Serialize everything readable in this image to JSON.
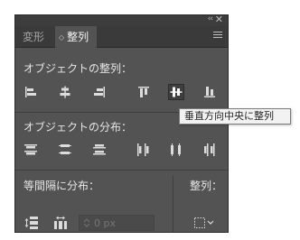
{
  "panel": {
    "title_bar": {
      "collapse_icon": "double-chevron-left-icon",
      "close_icon": "close-icon",
      "collapse_glyph": "‹‹",
      "close_glyph": "✕"
    },
    "tabs": [
      {
        "label": "変形",
        "active": false
      },
      {
        "label": "整列",
        "active": true,
        "arrows": "◇"
      }
    ],
    "menu_icon": "hamburger-menu-icon"
  },
  "align_objects": {
    "title": "オブジェクトの整列：",
    "buttons": [
      {
        "icon": "align-left-icon"
      },
      {
        "icon": "align-horizontal-center-icon"
      },
      {
        "icon": "align-right-icon"
      },
      {
        "icon": "align-top-icon"
      },
      {
        "icon": "align-vertical-center-icon",
        "active": true
      },
      {
        "icon": "align-bottom-icon"
      }
    ]
  },
  "distribute_objects": {
    "title": "オブジェクトの分布：",
    "buttons": [
      {
        "icon": "distribute-top-icon"
      },
      {
        "icon": "distribute-vertical-center-icon"
      },
      {
        "icon": "distribute-bottom-icon"
      },
      {
        "icon": "distribute-left-icon"
      },
      {
        "icon": "distribute-horizontal-center-icon"
      },
      {
        "icon": "distribute-right-icon"
      }
    ]
  },
  "distribute_spacing": {
    "title": "等間隔に分布：",
    "buttons": [
      {
        "icon": "vertical-distribute-space-icon"
      },
      {
        "icon": "horizontal-distribute-space-icon"
      }
    ],
    "spacing_input": {
      "placeholder": "0 px",
      "value": ""
    }
  },
  "align_to": {
    "title": "整列：",
    "icon": "align-to-selection-icon"
  },
  "tooltip": {
    "text": "垂直方向中央に整列"
  },
  "colors": {
    "panel_bg": "#535353",
    "tab_bar_bg": "#3a3a3a",
    "icon_color": "#dcdcdc",
    "tooltip_bg": "#f2f2f2"
  }
}
